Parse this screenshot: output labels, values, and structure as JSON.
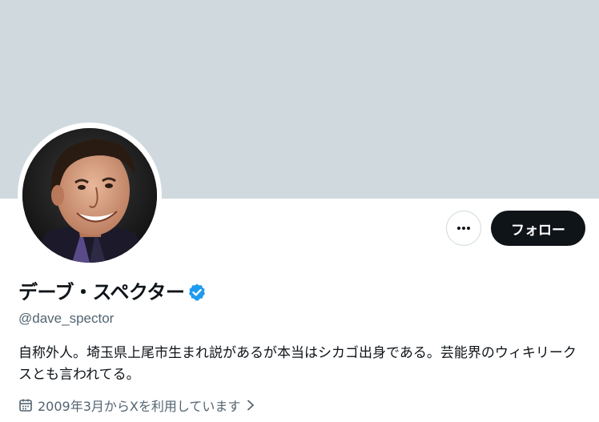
{
  "profile": {
    "display_name": "デーブ・スペクター",
    "handle": "@dave_spector",
    "verified": true,
    "bio": "自称外人。埼玉県上尾市生まれ説があるが本当はシカゴ出身である。芸能界のウィキリークスとも言われてる。",
    "joined": "2009年3月からXを利用しています"
  },
  "actions": {
    "more_icon": "more-horizontal-icon",
    "follow_label": "フォロー"
  },
  "colors": {
    "banner": "#cfd9de",
    "verified_badge": "#1d9bf0",
    "follow_button_bg": "#0f1419",
    "secondary_text": "#536471"
  }
}
